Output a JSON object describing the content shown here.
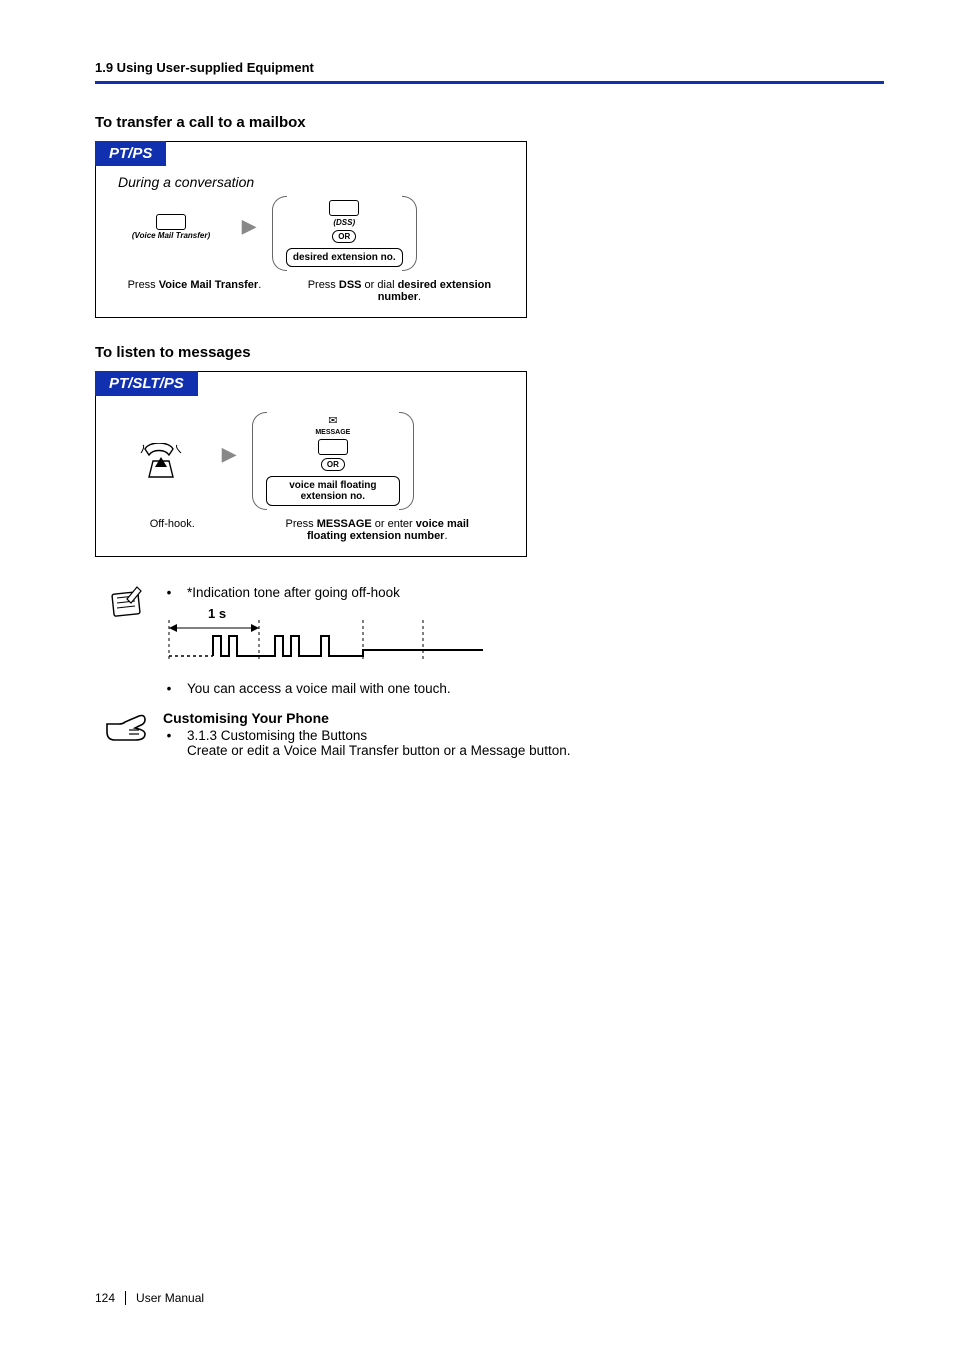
{
  "header": {
    "breadcrumb": "1.9 Using User-supplied Equipment"
  },
  "section1": {
    "title": "To transfer a call to a mailbox",
    "tab": "PT/PS",
    "context": "During a conversation",
    "step1_btn_label": "(Voice Mail Transfer)",
    "step1_caption_pre": "Press ",
    "step1_caption_b": "Voice Mail Transfer",
    "step1_caption_post": ".",
    "opt_dss_label": "(DSS)",
    "opt_or": "OR",
    "opt_desired": "desired extension no.",
    "step2_caption_pre": "Press ",
    "step2_caption_b1": "DSS",
    "step2_caption_mid": " or dial ",
    "step2_caption_b2": "desired extension number",
    "step2_caption_post": "."
  },
  "section2": {
    "title": "To listen to messages",
    "tab": "PT/SLT/PS",
    "step1_label": "Off-hook.",
    "opt_msg_icon": "MESSAGE",
    "opt_or": "OR",
    "opt_box": "voice mail floating extension no.",
    "step2_caption_pre": "Press ",
    "step2_caption_b1": "MESSAGE",
    "step2_caption_mid": " or enter ",
    "step2_caption_b2": "voice mail floating extension number",
    "step2_caption_post": "."
  },
  "notes": {
    "n1": "*Indication tone after going off-hook",
    "tone_label": "1 s",
    "n2": "You can access a voice mail with one touch."
  },
  "customising": {
    "title": "Customising Your Phone",
    "bullet_ref": "3.1.3 Customising the Buttons",
    "bullet_body": "Create or edit a Voice Mail Transfer button or a Message button."
  },
  "footer": {
    "page": "124",
    "doc": "User Manual"
  }
}
